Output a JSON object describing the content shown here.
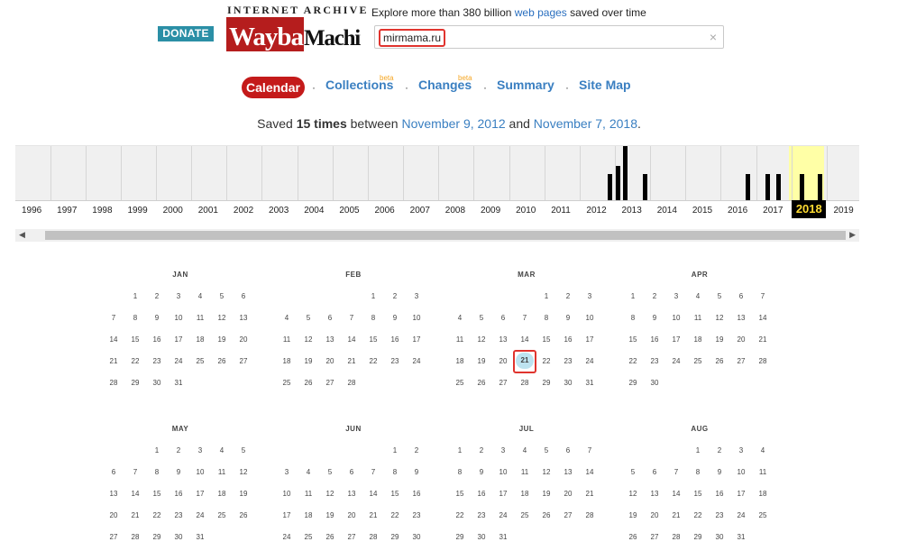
{
  "header": {
    "donate_label": "DONATE",
    "logo_top": "INTERNET ARCHIVE",
    "logo_main": "WaybackMachine",
    "tagline_prefix": "Explore more than 380 billion ",
    "tagline_link": "web pages",
    "tagline_suffix": " saved over time",
    "search_value": "mirmama.ru",
    "clear_glyph": "×"
  },
  "tabs": [
    {
      "label": "Calendar",
      "active": true
    },
    {
      "label": "Collections",
      "beta": "beta"
    },
    {
      "label": "Changes",
      "beta": "beta"
    },
    {
      "label": "Summary"
    },
    {
      "label": "Site Map"
    }
  ],
  "separator": "·",
  "summary": {
    "prefix": "Saved ",
    "count": "15 times",
    "between": " between ",
    "first_date": "November 9, 2012",
    "and": " and ",
    "last_date": "November 7, 2018",
    "end": "."
  },
  "timeline": {
    "years": [
      "1996",
      "1997",
      "1998",
      "1999",
      "2000",
      "2001",
      "2002",
      "2003",
      "2004",
      "2005",
      "2006",
      "2007",
      "2008",
      "2009",
      "2010",
      "2011",
      "2012",
      "2013",
      "2014",
      "2015",
      "2016",
      "2017",
      "2018",
      "2019"
    ],
    "selected_year": "2018"
  },
  "scroll": {
    "left_glyph": "◀",
    "right_glyph": "▶"
  },
  "calendar": {
    "months": [
      {
        "name": "JAN",
        "weeks": [
          [
            "",
            "1",
            "2",
            "3",
            "4",
            "5",
            "6"
          ],
          [
            "7",
            "8",
            "9",
            "10",
            "11",
            "12",
            "13"
          ],
          [
            "14",
            "15",
            "16",
            "17",
            "18",
            "19",
            "20"
          ],
          [
            "21",
            "22",
            "23",
            "24",
            "25",
            "26",
            "27"
          ],
          [
            "28",
            "29",
            "30",
            "31",
            "",
            "",
            ""
          ]
        ]
      },
      {
        "name": "FEB",
        "weeks": [
          [
            "",
            "",
            "",
            "",
            "1",
            "2",
            "3"
          ],
          [
            "4",
            "5",
            "6",
            "7",
            "8",
            "9",
            "10"
          ],
          [
            "11",
            "12",
            "13",
            "14",
            "15",
            "16",
            "17"
          ],
          [
            "18",
            "19",
            "20",
            "21",
            "22",
            "23",
            "24"
          ],
          [
            "25",
            "26",
            "27",
            "28",
            "",
            "",
            ""
          ]
        ]
      },
      {
        "name": "MAR",
        "weeks": [
          [
            "",
            "",
            "",
            "",
            "1",
            "2",
            "3"
          ],
          [
            "4",
            "5",
            "6",
            "7",
            "8",
            "9",
            "10"
          ],
          [
            "11",
            "12",
            "13",
            "14",
            "15",
            "16",
            "17"
          ],
          [
            "18",
            "19",
            "20",
            "21",
            "22",
            "23",
            "24"
          ],
          [
            "25",
            "26",
            "27",
            "28",
            "29",
            "30",
            "31"
          ]
        ]
      },
      {
        "name": "APR",
        "weeks": [
          [
            "1",
            "2",
            "3",
            "4",
            "5",
            "6",
            "7"
          ],
          [
            "8",
            "9",
            "10",
            "11",
            "12",
            "13",
            "14"
          ],
          [
            "15",
            "16",
            "17",
            "18",
            "19",
            "20",
            "21"
          ],
          [
            "22",
            "23",
            "24",
            "25",
            "26",
            "27",
            "28"
          ],
          [
            "29",
            "30",
            "",
            "",
            "",
            "",
            ""
          ]
        ]
      },
      {
        "name": "MAY",
        "weeks": [
          [
            "",
            "",
            "1",
            "2",
            "3",
            "4",
            "5"
          ],
          [
            "6",
            "7",
            "8",
            "9",
            "10",
            "11",
            "12"
          ],
          [
            "13",
            "14",
            "15",
            "16",
            "17",
            "18",
            "19"
          ],
          [
            "20",
            "21",
            "22",
            "23",
            "24",
            "25",
            "26"
          ],
          [
            "27",
            "28",
            "29",
            "30",
            "31",
            "",
            ""
          ]
        ]
      },
      {
        "name": "JUN",
        "weeks": [
          [
            "",
            "",
            "",
            "",
            "",
            "1",
            "2"
          ],
          [
            "3",
            "4",
            "5",
            "6",
            "7",
            "8",
            "9"
          ],
          [
            "10",
            "11",
            "12",
            "13",
            "14",
            "15",
            "16"
          ],
          [
            "17",
            "18",
            "19",
            "20",
            "21",
            "22",
            "23"
          ],
          [
            "24",
            "25",
            "26",
            "27",
            "28",
            "29",
            "30"
          ]
        ]
      },
      {
        "name": "JUL",
        "weeks": [
          [
            "1",
            "2",
            "3",
            "4",
            "5",
            "6",
            "7"
          ],
          [
            "8",
            "9",
            "10",
            "11",
            "12",
            "13",
            "14"
          ],
          [
            "15",
            "16",
            "17",
            "18",
            "19",
            "20",
            "21"
          ],
          [
            "22",
            "23",
            "24",
            "25",
            "26",
            "27",
            "28"
          ],
          [
            "29",
            "30",
            "31",
            "",
            "",
            "",
            ""
          ]
        ]
      },
      {
        "name": "AUG",
        "weeks": [
          [
            "",
            "",
            "",
            "1",
            "2",
            "3",
            "4"
          ],
          [
            "5",
            "6",
            "7",
            "8",
            "9",
            "10",
            "11"
          ],
          [
            "12",
            "13",
            "14",
            "15",
            "16",
            "17",
            "18"
          ],
          [
            "19",
            "20",
            "21",
            "22",
            "23",
            "24",
            "25"
          ],
          [
            "26",
            "27",
            "28",
            "29",
            "30",
            "31",
            ""
          ]
        ]
      }
    ],
    "snapshot_days": [
      {
        "month": 2,
        "day": "21"
      }
    ]
  }
}
